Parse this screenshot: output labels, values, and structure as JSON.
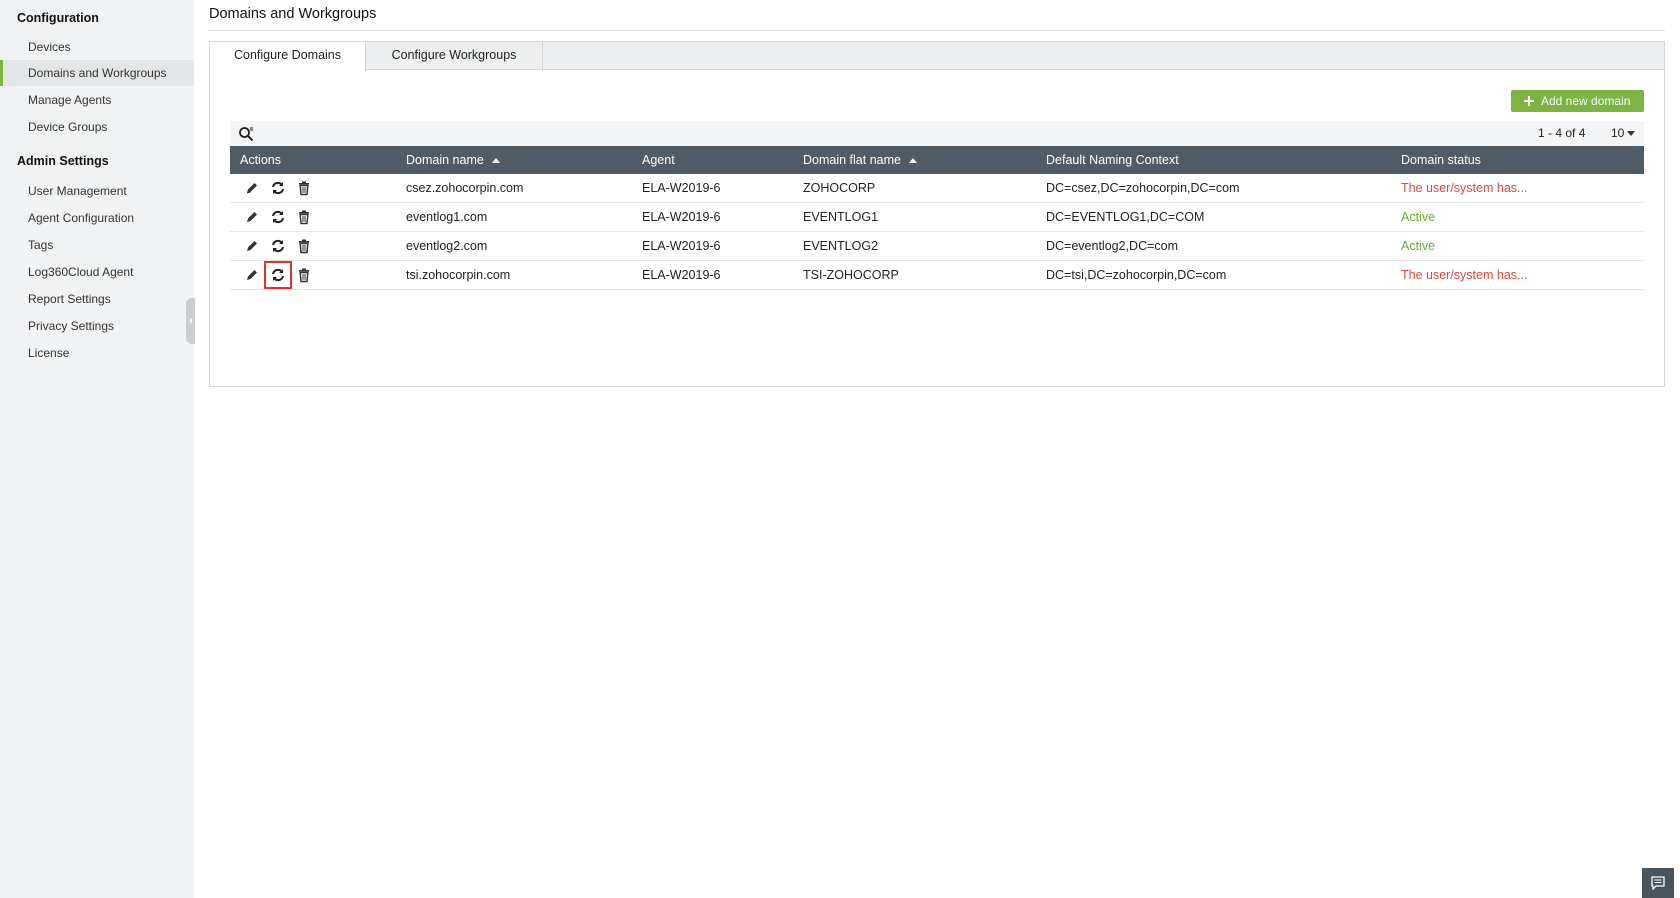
{
  "sidebar": {
    "section_config": "Configuration",
    "config_items": [
      {
        "label": "Devices"
      },
      {
        "label": "Domains and Workgroups"
      },
      {
        "label": "Manage Agents"
      },
      {
        "label": "Device Groups"
      }
    ],
    "section_admin": "Admin Settings",
    "admin_items": [
      {
        "label": "User Management"
      },
      {
        "label": "Agent Configuration"
      },
      {
        "label": "Tags"
      },
      {
        "label": "Log360Cloud Agent"
      },
      {
        "label": "Report Settings"
      },
      {
        "label": "Privacy Settings"
      },
      {
        "label": "License"
      }
    ]
  },
  "page": {
    "title": "Domains and Workgroups"
  },
  "tabs": [
    {
      "label": "Configure Domains",
      "active": true
    },
    {
      "label": "Configure Workgroups",
      "active": false
    }
  ],
  "toolbar": {
    "add_label": "Add new domain",
    "pager_text": "1 - 4 of 4",
    "per_page": "10"
  },
  "table": {
    "columns": [
      "Actions",
      "Domain name",
      "Agent",
      "Domain flat name",
      "Default Naming Context",
      "Domain status"
    ],
    "rows": [
      {
        "domain": "csez.zohocorpin.com",
        "agent": "ELA-W2019-6",
        "flat": "ZOHOCORP",
        "context": "DC=csez,DC=zohocorpin,DC=com",
        "status": "The user/system has...",
        "status_type": "error"
      },
      {
        "domain": "eventlog1.com",
        "agent": "ELA-W2019-6",
        "flat": "EVENTLOG1",
        "context": "DC=EVENTLOG1,DC=COM",
        "status": "Active",
        "status_type": "ok"
      },
      {
        "domain": "eventlog2.com",
        "agent": "ELA-W2019-6",
        "flat": "EVENTLOG2",
        "context": "DC=eventlog2,DC=com",
        "status": "Active",
        "status_type": "ok"
      },
      {
        "domain": "tsi.zohocorpin.com",
        "agent": "ELA-W2019-6",
        "flat": "TSI-ZOHOCORP",
        "context": "DC=tsi,DC=zohocorpin,DC=com",
        "status": "The user/system has...",
        "status_type": "error"
      }
    ]
  },
  "colors": {
    "accent": "#7cb342",
    "header_bg": "#505c65",
    "error": "#e0453e",
    "ok": "#6aaa2e",
    "highlight": "#e0302c"
  },
  "icons": {
    "edit": "pencil-icon",
    "sync": "refresh-icon",
    "delete": "trash-icon",
    "search": "search-icon",
    "chat": "chat-icon"
  }
}
